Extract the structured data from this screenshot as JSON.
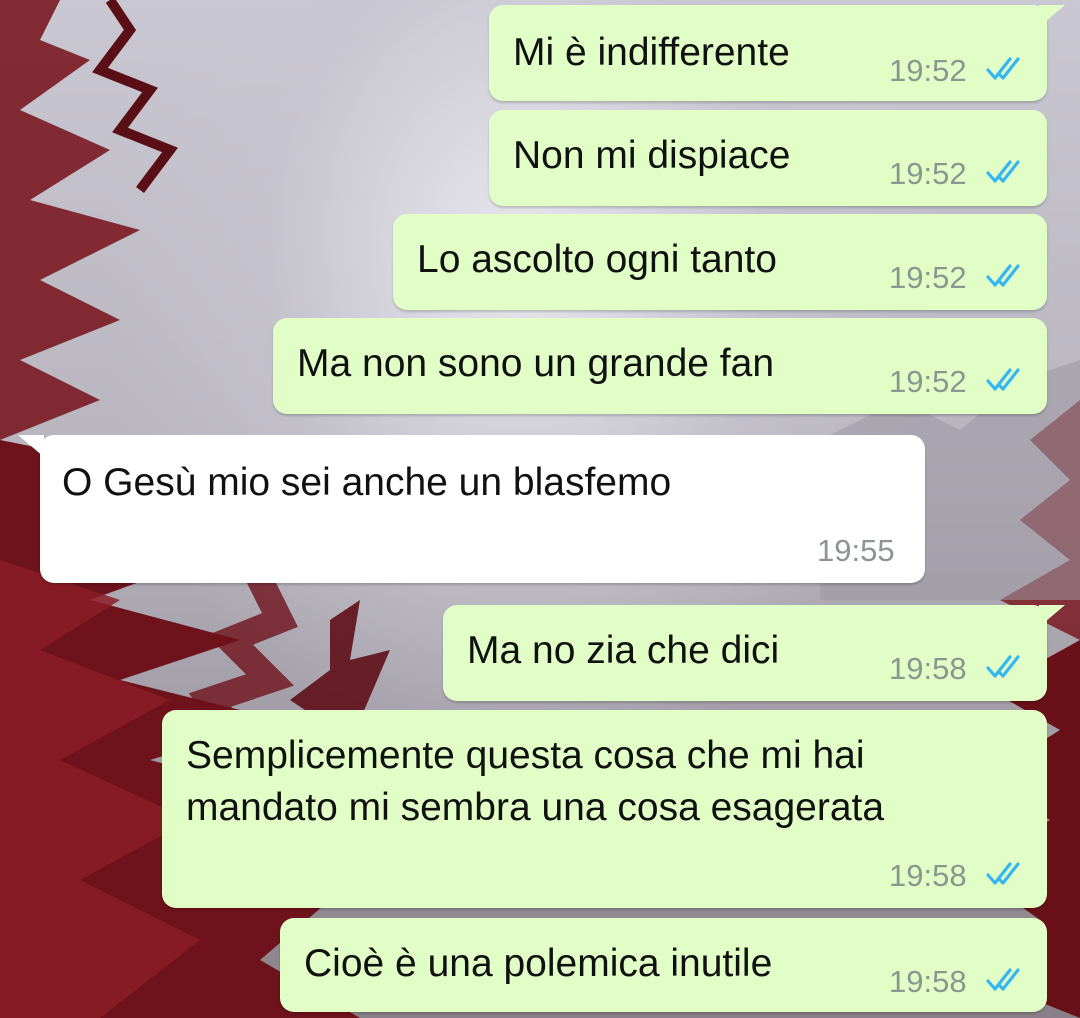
{
  "chat": {
    "messages": [
      {
        "text": "Mi è indifferente",
        "time": "19:52",
        "direction": "outgoing",
        "status": "read"
      },
      {
        "text": "Non mi dispiace",
        "time": "19:52",
        "direction": "outgoing",
        "status": "read"
      },
      {
        "text": "Lo ascolto ogni tanto",
        "time": "19:52",
        "direction": "outgoing",
        "status": "read"
      },
      {
        "text": "Ma non sono un grande fan",
        "time": "19:52",
        "direction": "outgoing",
        "status": "read"
      },
      {
        "text": "O Gesù mio sei anche un blasfemo",
        "time": "19:55",
        "direction": "incoming"
      },
      {
        "text": "Ma no zia che dici",
        "time": "19:58",
        "direction": "outgoing",
        "status": "read"
      },
      {
        "text_lines": [
          "Semplicemente questa cosa che mi hai",
          "mandato mi sembra una cosa esagerata"
        ],
        "time": "19:58",
        "direction": "outgoing",
        "status": "read"
      },
      {
        "text": "Cioè è una polemica inutile",
        "time": "19:58",
        "direction": "outgoing",
        "status": "read"
      }
    ]
  },
  "colors": {
    "outgoing_bubble": "#e2fec7",
    "incoming_bubble": "#ffffff",
    "read_ticks": "#34b7f1",
    "meta_text": "#8b9690"
  },
  "icons": {
    "read_receipt": "double-check-icon"
  }
}
